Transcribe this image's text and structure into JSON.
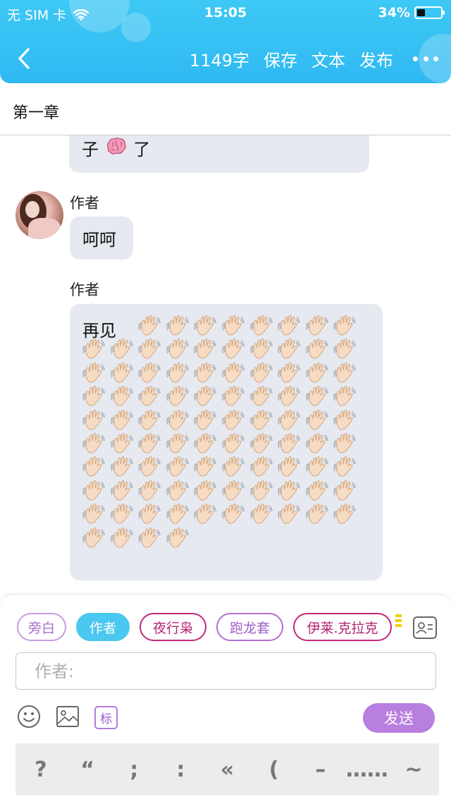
{
  "status_bar": {
    "carrier": "无 SIM 卡",
    "time": "15:05",
    "battery": "34%",
    "battery_level": 0.34
  },
  "nav": {
    "word_count": "1149字",
    "save": "保存",
    "text": "文本",
    "publish": "发布"
  },
  "chapter": {
    "title": "第一章"
  },
  "chat": {
    "previous_bubble_tail": "子",
    "previous_bubble_end": "了",
    "messages": [
      {
        "speaker": "作者",
        "text": "呵呵"
      },
      {
        "speaker": "作者",
        "text": "再见",
        "emoji": "waving-hand",
        "emoji_count": 92
      }
    ]
  },
  "compose": {
    "characters": [
      "旁白",
      "作者",
      "夜行枭",
      "跑龙套",
      "伊莱.克拉克"
    ],
    "selected_character": "作者",
    "input_placeholder": "作者:",
    "tag_label": "标",
    "send_label": "发送",
    "punctuation": [
      "?",
      "“",
      ";",
      ":",
      "«",
      "(",
      "–",
      "……",
      "~"
    ]
  },
  "colors": {
    "header": "#2fb9f2",
    "bubble": "#e6e9ef",
    "send": "#b87ee0",
    "selected_chip": "#4bc8f0"
  }
}
